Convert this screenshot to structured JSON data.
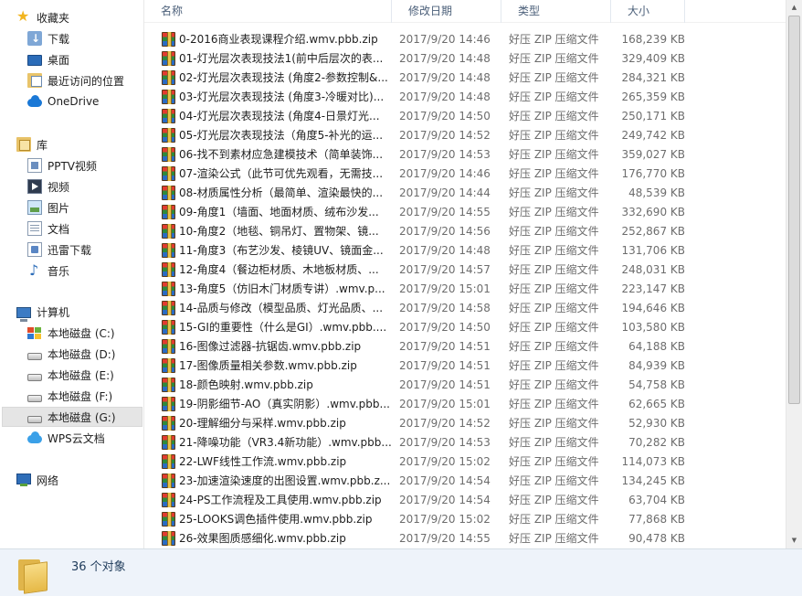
{
  "nav": {
    "favorites": {
      "label": "收藏夹",
      "items": [
        "下载",
        "桌面",
        "最近访问的位置"
      ]
    },
    "onedrive": "OneDrive",
    "libraries": {
      "label": "库",
      "items": [
        "PPTV视频",
        "视频",
        "图片",
        "文档",
        "迅雷下载",
        "音乐"
      ]
    },
    "computer": {
      "label": "计算机",
      "drives": [
        "本地磁盘 (C:)",
        "本地磁盘 (D:)",
        "本地磁盘 (E:)",
        "本地磁盘 (F:)",
        "本地磁盘 (G:)"
      ],
      "selected": "本地磁盘 (G:)"
    },
    "wps": "WPS云文档",
    "network": "网络"
  },
  "columns": {
    "name": "名称",
    "date": "修改日期",
    "type": "类型",
    "size": "大小"
  },
  "files": [
    {
      "name": "0-2016商业表现课程介绍.wmv.pbb.zip",
      "date": "2017/9/20 14:46",
      "type": "好压 ZIP 压缩文件",
      "size": "168,239 KB"
    },
    {
      "name": "01-灯光层次表现技法1(前中后层次的表...",
      "date": "2017/9/20 14:48",
      "type": "好压 ZIP 压缩文件",
      "size": "329,409 KB"
    },
    {
      "name": "02-灯光层次表现技法 (角度2-参数控制&...",
      "date": "2017/9/20 14:48",
      "type": "好压 ZIP 压缩文件",
      "size": "284,321 KB"
    },
    {
      "name": "03-灯光层次表现技法 (角度3-冷暖对比)...",
      "date": "2017/9/20 14:48",
      "type": "好压 ZIP 压缩文件",
      "size": "265,359 KB"
    },
    {
      "name": "04-灯光层次表现技法 (角度4-日景灯光...",
      "date": "2017/9/20 14:50",
      "type": "好压 ZIP 压缩文件",
      "size": "250,171 KB"
    },
    {
      "name": "05-灯光层次表现技法（角度5-补光的运...",
      "date": "2017/9/20 14:52",
      "type": "好压 ZIP 压缩文件",
      "size": "249,742 KB"
    },
    {
      "name": "06-找不到素材应急建模技术（简单装饰...",
      "date": "2017/9/20 14:53",
      "type": "好压 ZIP 压缩文件",
      "size": "359,027 KB"
    },
    {
      "name": "07-渲染公式（此节可优先观看，无需技...",
      "date": "2017/9/20 14:46",
      "type": "好压 ZIP 压缩文件",
      "size": "176,770 KB"
    },
    {
      "name": "08-材质属性分析（最简单、渲染最快的...",
      "date": "2017/9/20 14:44",
      "type": "好压 ZIP 压缩文件",
      "size": "48,539 KB"
    },
    {
      "name": "09-角度1（墙面、地面材质、绒布沙发...",
      "date": "2017/9/20 14:55",
      "type": "好压 ZIP 压缩文件",
      "size": "332,690 KB"
    },
    {
      "name": "10-角度2（地毯、铜吊灯、置物架、镜...",
      "date": "2017/9/20 14:56",
      "type": "好压 ZIP 压缩文件",
      "size": "252,867 KB"
    },
    {
      "name": "11-角度3（布艺沙发、棱镜UV、镜面金...",
      "date": "2017/9/20 14:48",
      "type": "好压 ZIP 压缩文件",
      "size": "131,706 KB"
    },
    {
      "name": "12-角度4（餐边柜材质、木地板材质、...",
      "date": "2017/9/20 14:57",
      "type": "好压 ZIP 压缩文件",
      "size": "248,031 KB"
    },
    {
      "name": "13-角度5（仿旧木门材质专讲）.wmv.p...",
      "date": "2017/9/20 15:01",
      "type": "好压 ZIP 压缩文件",
      "size": "223,147 KB"
    },
    {
      "name": "14-品质与修改（模型品质、灯光品质、...",
      "date": "2017/9/20 14:58",
      "type": "好压 ZIP 压缩文件",
      "size": "194,646 KB"
    },
    {
      "name": "15-GI的重要性（什么是GI）.wmv.pbb....",
      "date": "2017/9/20 14:50",
      "type": "好压 ZIP 压缩文件",
      "size": "103,580 KB"
    },
    {
      "name": "16-图像过滤器-抗锯齿.wmv.pbb.zip",
      "date": "2017/9/20 14:51",
      "type": "好压 ZIP 压缩文件",
      "size": "64,188 KB"
    },
    {
      "name": "17-图像质量相关参数.wmv.pbb.zip",
      "date": "2017/9/20 14:51",
      "type": "好压 ZIP 压缩文件",
      "size": "84,939 KB"
    },
    {
      "name": "18-颜色映射.wmv.pbb.zip",
      "date": "2017/9/20 14:51",
      "type": "好压 ZIP 压缩文件",
      "size": "54,758 KB"
    },
    {
      "name": "19-阴影细节-AO（真实阴影）.wmv.pbb...",
      "date": "2017/9/20 15:01",
      "type": "好压 ZIP 压缩文件",
      "size": "62,665 KB"
    },
    {
      "name": "20-理解细分与采样.wmv.pbb.zip",
      "date": "2017/9/20 14:52",
      "type": "好压 ZIP 压缩文件",
      "size": "52,930 KB"
    },
    {
      "name": "21-降噪功能（VR3.4新功能）.wmv.pbb...",
      "date": "2017/9/20 14:53",
      "type": "好压 ZIP 压缩文件",
      "size": "70,282 KB"
    },
    {
      "name": "22-LWF线性工作流.wmv.pbb.zip",
      "date": "2017/9/20 15:02",
      "type": "好压 ZIP 压缩文件",
      "size": "114,073 KB"
    },
    {
      "name": "23-加速渲染速度的出图设置.wmv.pbb.z...",
      "date": "2017/9/20 14:54",
      "type": "好压 ZIP 压缩文件",
      "size": "134,245 KB"
    },
    {
      "name": "24-PS工作流程及工具使用.wmv.pbb.zip",
      "date": "2017/9/20 14:54",
      "type": "好压 ZIP 压缩文件",
      "size": "63,704 KB"
    },
    {
      "name": "25-LOOKS调色插件使用.wmv.pbb.zip",
      "date": "2017/9/20 15:02",
      "type": "好压 ZIP 压缩文件",
      "size": "77,868 KB"
    },
    {
      "name": "26-效果图质感细化.wmv.pbb.zip",
      "date": "2017/9/20 14:55",
      "type": "好压 ZIP 压缩文件",
      "size": "90,478 KB"
    }
  ],
  "status": {
    "count": "36 个对象"
  }
}
